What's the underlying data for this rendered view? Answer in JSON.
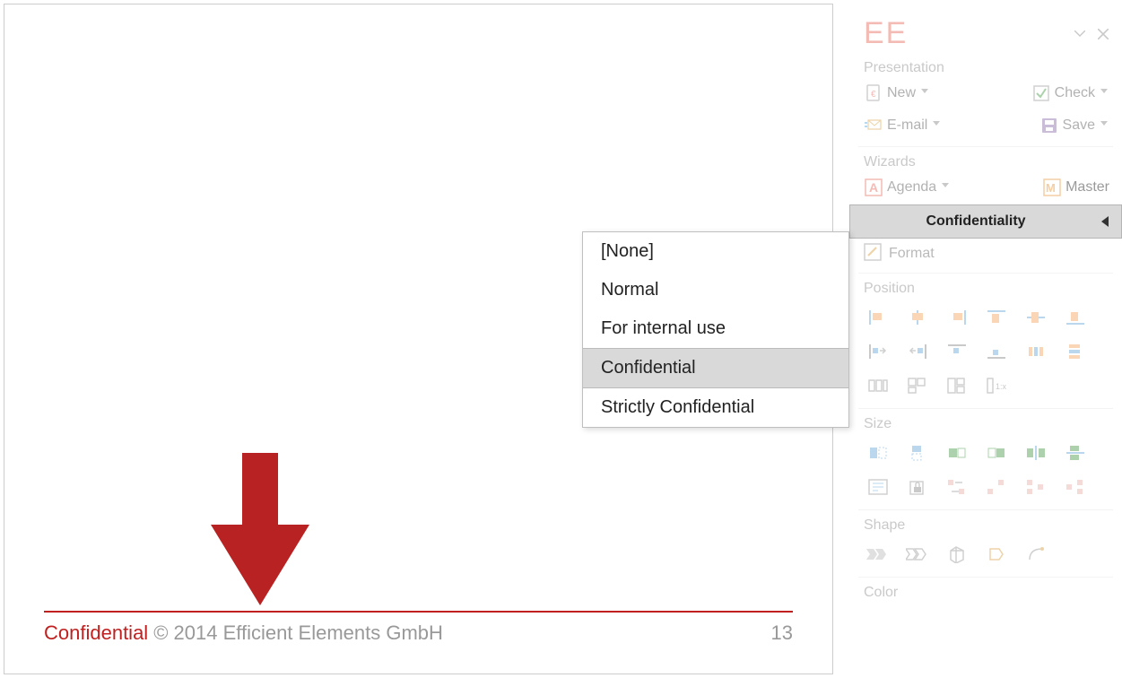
{
  "slide": {
    "confidentiality_label": "Confidential",
    "copyright": "© 2014 Efficient Elements GmbH",
    "page_number": "13"
  },
  "popup": {
    "items": [
      "[None]",
      "Normal",
      "For internal use",
      "Confidential",
      "Strictly Confidential"
    ],
    "selected_index": 3
  },
  "panel": {
    "logo": "EE",
    "sections": {
      "presentation": {
        "label": "Presentation",
        "new": "New",
        "check": "Check",
        "email": "E-mail",
        "save": "Save"
      },
      "wizards": {
        "label": "Wizards",
        "agenda": "Agenda",
        "master": "Master",
        "confidentiality": "Confidentiality",
        "format": "Format"
      },
      "position": {
        "label": "Position"
      },
      "size": {
        "label": "Size"
      },
      "shape": {
        "label": "Shape"
      },
      "color": {
        "label": "Color"
      }
    }
  }
}
